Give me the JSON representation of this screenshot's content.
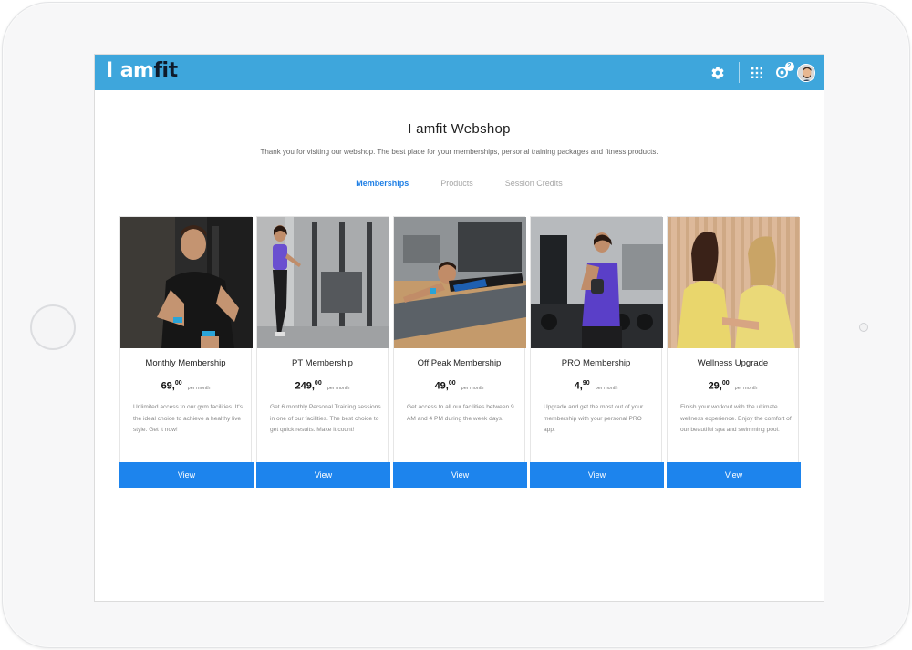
{
  "header": {
    "logo_i": "I",
    "logo_am": "am",
    "logo_fit": "fit",
    "notification_count": "2",
    "accent_color": "#3ea6dc"
  },
  "page": {
    "title": "I amfit Webshop",
    "subtitle": "Thank you for visiting our webshop. The best place for your memberships, personal training packages and fitness products."
  },
  "tabs": [
    {
      "label": "Memberships",
      "active": true
    },
    {
      "label": "Products",
      "active": false
    },
    {
      "label": "Session Credits",
      "active": false
    }
  ],
  "cards": [
    {
      "name": "Monthly Membership",
      "price_whole": "69,",
      "price_cents": "00",
      "per": "per month",
      "desc": "Unlimited access to our gym facilities. It's the ideal choice to achieve a healthy live style. Get it now!",
      "button": "View"
    },
    {
      "name": "PT Membership",
      "price_whole": "249,",
      "price_cents": "00",
      "per": "per month",
      "desc": "Get 6 monthly Personal Training sessions in one of our facilities. The best choice to get quick results. Make it count!",
      "button": "View"
    },
    {
      "name": "Off Peak Membership",
      "price_whole": "49,",
      "price_cents": "00",
      "per": "per month",
      "desc": "Get access to all our facilities between 9 AM and 4 PM during the week days.",
      "button": "View"
    },
    {
      "name": "PRO Membership",
      "price_whole": "4,",
      "price_cents": "90",
      "per": "per month",
      "desc": "Upgrade and get the most out of your membership with your personal PRO app.",
      "button": "View"
    },
    {
      "name": "Wellness Upgrade",
      "price_whole": "29,",
      "price_cents": "00",
      "per": "per month",
      "desc": "Finish your workout with the ultimate wellness experience. Enjoy the comfort of our beautiful spa and swimming pool.",
      "button": "View"
    }
  ],
  "colors": {
    "button_blue": "#1d84ed",
    "active_tab": "#1f7fe5"
  }
}
